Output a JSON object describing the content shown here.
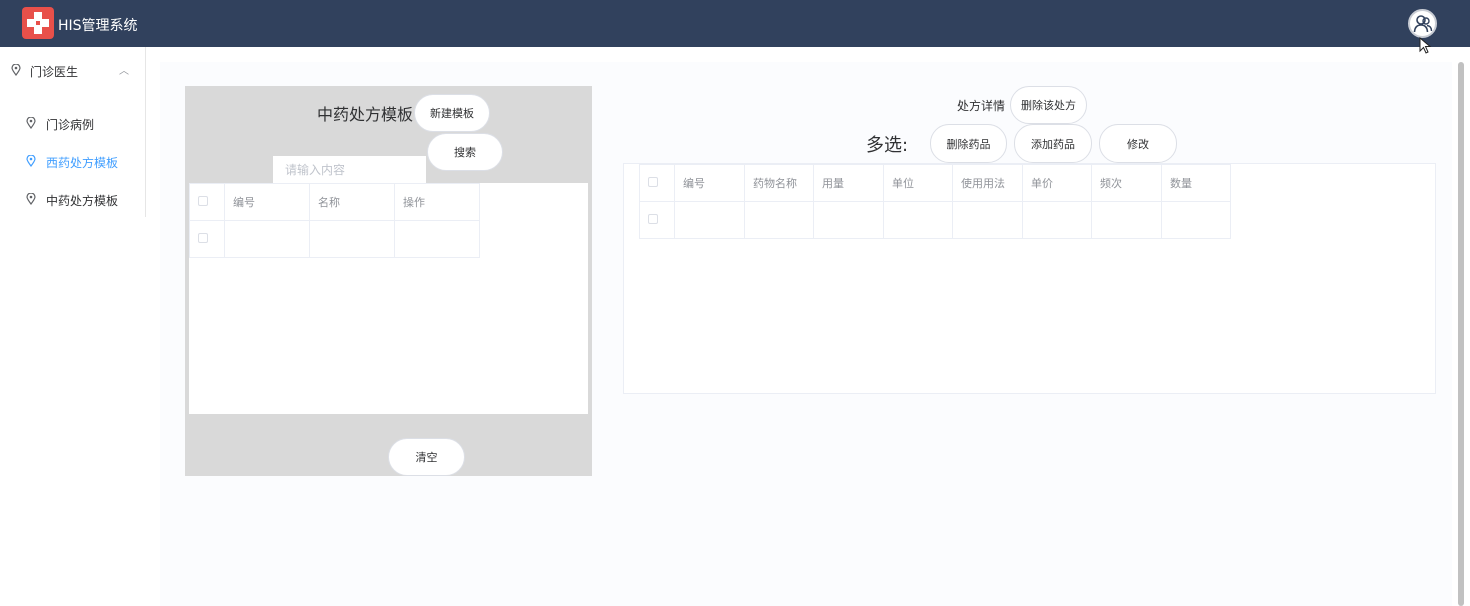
{
  "header": {
    "app_title": "HIS管理系统",
    "logo_icon": "red-cross-logo-icon",
    "avatar_icon": "user-avatar-icon",
    "colors": {
      "bar": "#31415d",
      "logo": "#e8504a"
    }
  },
  "sidebar": {
    "group_label": "门诊医生",
    "items": [
      {
        "label": "门诊病例",
        "active": false
      },
      {
        "label": "西药处方模板",
        "active": true
      },
      {
        "label": "中药处方模板",
        "active": false
      }
    ],
    "active_color": "#409eff"
  },
  "template_panel": {
    "title": "中药处方模板",
    "new_button": "新建模板",
    "search_button": "搜索",
    "search_placeholder": "请输入内容",
    "columns": [
      "编号",
      "名称",
      "操作"
    ],
    "clear_button": "清空"
  },
  "detail_panel": {
    "detail_label": "处方详情",
    "delete_prescription_button": "删除该处方",
    "multi_select_label": "多选:",
    "delete_drug_button": "删除药品",
    "add_drug_button": "添加药品",
    "edit_button": "修改",
    "columns": [
      "编号",
      "药物名称",
      "用量",
      "单位",
      "使用用法",
      "单价",
      "频次",
      "数量"
    ]
  }
}
